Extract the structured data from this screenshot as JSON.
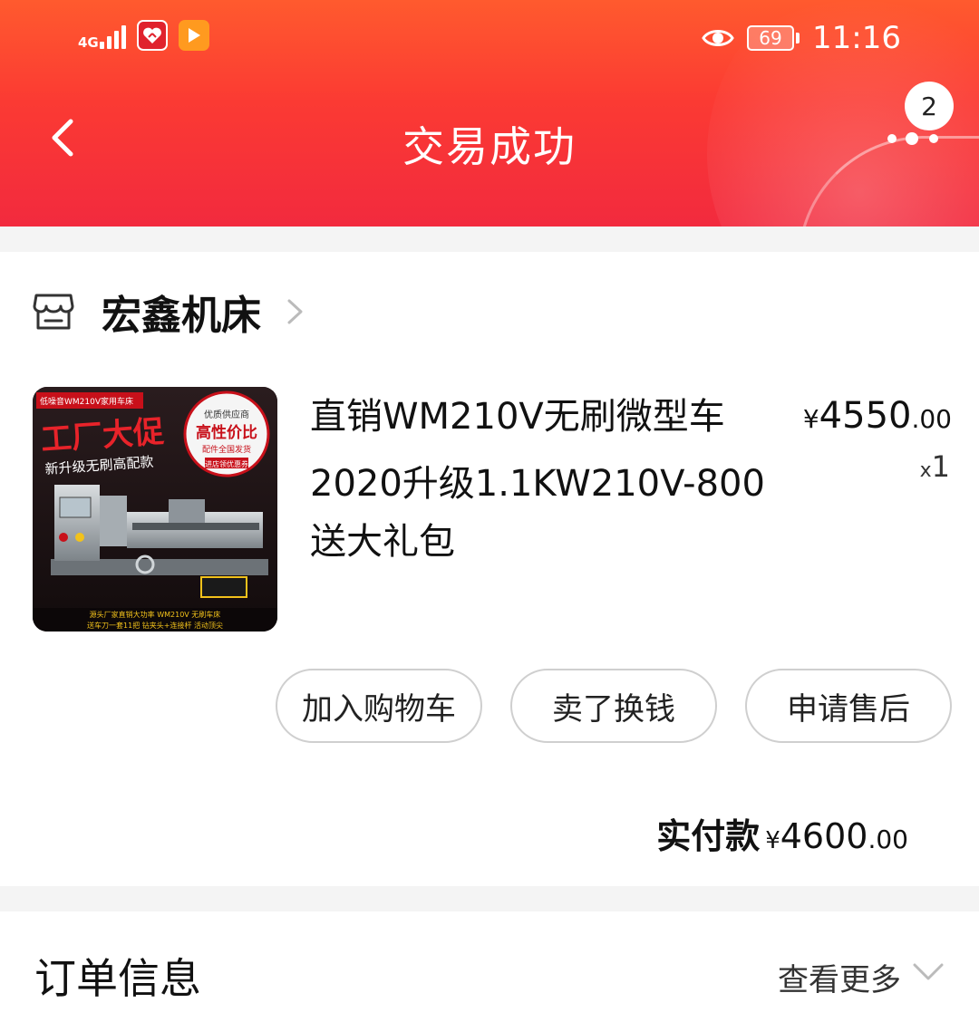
{
  "status_bar": {
    "network": "4G",
    "battery": "69",
    "time": "11:16"
  },
  "header": {
    "title": "交易成功",
    "message_badge": "2"
  },
  "order": {
    "shop_name": "宏鑫机床",
    "product": {
      "title_line1": "直销WM210V无刷微型车",
      "title_line2": "2020升级1.1KW210V-800送大礼包",
      "price_symbol": "¥",
      "price_int": "4550",
      "price_dec": ".00",
      "qty_prefix": "x",
      "qty": "1",
      "image": {
        "top_tag": "低噪音WM210V家用车床",
        "headline": "工厂大促",
        "sub": "新升级无刷高配款",
        "badge_l1": "优质供应商",
        "badge_l2": "高性价比",
        "badge_l3": "配件全国发货",
        "badge_l4": "进店领优惠券",
        "footer_l1": "源头厂家直销大功率 WM210V 无刷车床",
        "footer_l2": "送车刀一套11把 钻夹头+连接杆 活动顶尖"
      }
    },
    "actions": {
      "add_cart": "加入购物车",
      "sell": "卖了换钱",
      "after_sale": "申请售后"
    },
    "paid": {
      "label": "实付款",
      "symbol": "¥",
      "int": "4600",
      "dec": ".00"
    }
  },
  "order_info": {
    "title": "订单信息",
    "more": "查看更多"
  },
  "colors": {
    "header_start": "#ff5a2e",
    "header_end": "#f22a3e"
  }
}
